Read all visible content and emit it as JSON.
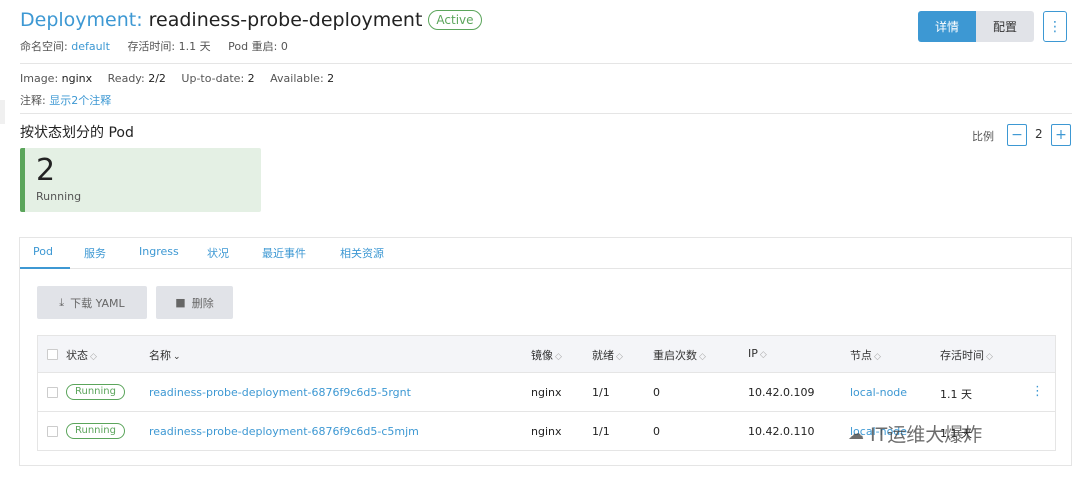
{
  "header": {
    "kind": "Deployment:",
    "name": "readiness-probe-deployment",
    "status": "Active",
    "namespace_label": "命名空间:",
    "namespace_value": "default",
    "age_label": "存活时间:",
    "age_value": "1.1 天",
    "restarts_label": "Pod 重启:",
    "restarts_value": "0",
    "detail_button": "详情",
    "config_button": "配置",
    "more_button": "⋮"
  },
  "info": {
    "image_label": "Image:",
    "image_value": "nginx",
    "ready_label": "Ready:",
    "ready_value": "2/2",
    "uptodate_label": "Up-to-date:",
    "uptodate_value": "2",
    "available_label": "Available:",
    "available_value": "2",
    "annotation_label": "注释:",
    "annotation_link": "显示2个注释"
  },
  "pods_section": {
    "title": "按状态划分的 Pod",
    "scale_label": "比例",
    "scale_minus": "−",
    "scale_value": "2",
    "scale_plus": "+",
    "state_count": "2",
    "state_label": "Running"
  },
  "tabs": [
    "Pod",
    "服务",
    "Ingress",
    "状况",
    "最近事件",
    "相关资源"
  ],
  "actions": {
    "download_icon": "download-icon",
    "download_label": "下载 YAML",
    "delete_icon": "trash-icon",
    "delete_label": "删除"
  },
  "table": {
    "headers": [
      "状态",
      "名称",
      "镜像",
      "就绪",
      "重启次数",
      "IP",
      "节点",
      "存活时间"
    ],
    "rows": [
      {
        "status": "Running",
        "name": "readiness-probe-deployment-6876f9c6d5-5rgnt",
        "image": "nginx",
        "ready": "1/1",
        "restarts": "0",
        "ip": "10.42.0.109",
        "node": "local-node",
        "age": "1.1 天"
      },
      {
        "status": "Running",
        "name": "readiness-probe-deployment-6876f9c6d5-c5mjm",
        "image": "nginx",
        "ready": "1/1",
        "restarts": "0",
        "ip": "10.42.0.110",
        "node": "local-node",
        "age": "1.1 天"
      }
    ]
  },
  "watermark": "IT运维大爆炸",
  "colors": {
    "accent": "#3d98d3",
    "success": "#5ba55b",
    "button_gray": "#e1e3e8"
  }
}
